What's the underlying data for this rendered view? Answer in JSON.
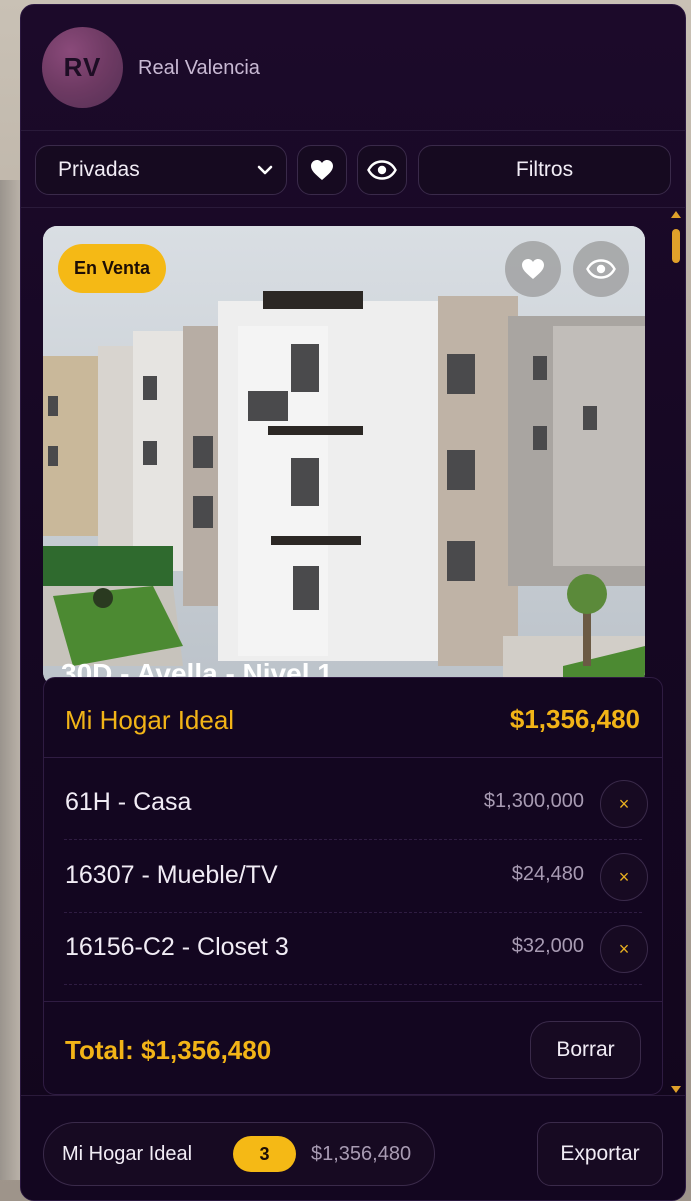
{
  "header": {
    "avatar_initials": "RV",
    "brand": "Real Valencia"
  },
  "filters": {
    "select_value": "Privadas",
    "filtros_label": "Filtros"
  },
  "card": {
    "badge": "En Venta",
    "caption": "30D - Avella - Nivel 1"
  },
  "summary": {
    "title": "Mi Hogar Ideal",
    "price": "$1,356,480",
    "items": [
      {
        "label": "61H - Casa",
        "amount": "$1,300,000"
      },
      {
        "label": "16307 - Mueble/TV",
        "amount": "$24,480"
      },
      {
        "label": "16156-C2 - Closet 3",
        "amount": "$32,000"
      }
    ],
    "remove_glyph": "×",
    "total": "Total: $1,356,480",
    "clear_label": "Borrar"
  },
  "footer": {
    "pill_label": "Mi Hogar Ideal",
    "count": "3",
    "pill_amount": "$1,356,480",
    "export_label": "Exportar"
  },
  "colors": {
    "accent": "#f5b915",
    "panel": "#150722"
  }
}
